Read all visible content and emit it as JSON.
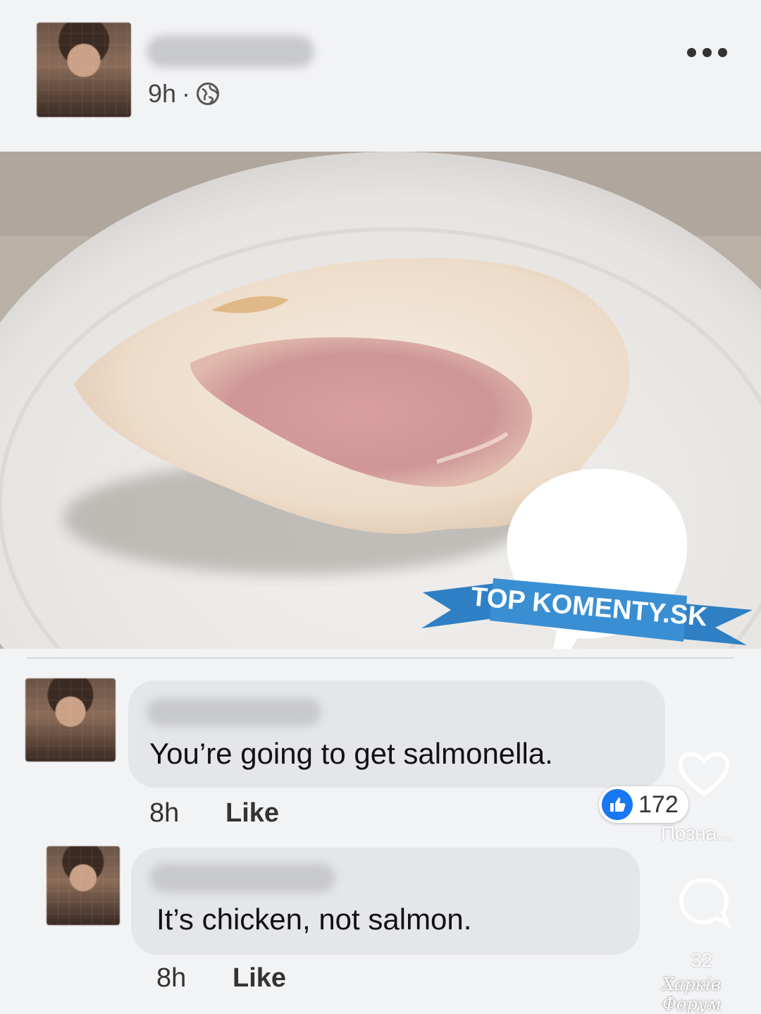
{
  "post": {
    "time": "9h",
    "separator": "·",
    "more_icon": "more-horizontal-icon",
    "visibility_icon": "globe-icon"
  },
  "photo": {
    "badge_text": "TOP KOMENTY.SK"
  },
  "comments": [
    {
      "text": "You’re going to get salmonella.",
      "time": "8h",
      "like_label": "Like",
      "reaction_count": "172"
    },
    {
      "text": "It’s chicken, not salmon.",
      "time": "8h",
      "like_label": "Like"
    }
  ],
  "overlay": {
    "likes_label": "Позна...",
    "comments_count": "32",
    "watermark": "Харків Форум"
  },
  "colors": {
    "like_blue": "#1877f2",
    "badge_blue": "#3a8fd3",
    "bubble_grey": "#e4e6e9"
  }
}
